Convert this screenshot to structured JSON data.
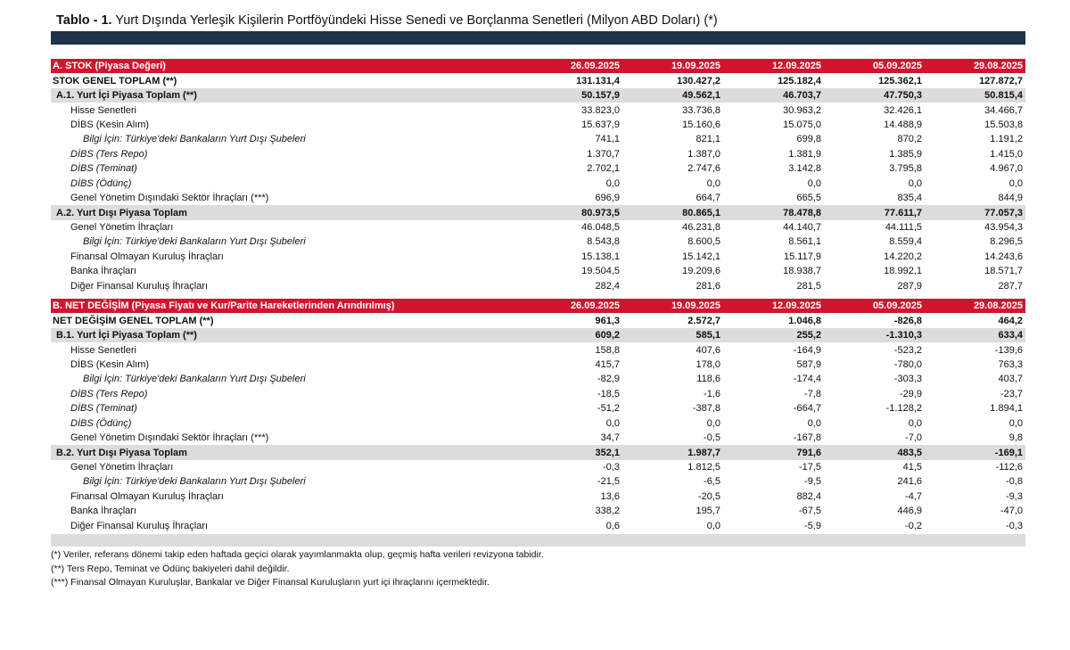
{
  "title": {
    "prefix": "Tablo - 1.",
    "text": " Yurt Dışında Yerleşik Kişilerin Portföyündeki Hisse Senedi ve Borçlanma Senetleri (Milyon ABD Doları) (*)"
  },
  "colors": {
    "header_red": "#d2142e",
    "navy_bar": "#1f3349",
    "subtotal_gray": "#dcdcdc"
  },
  "sections": [
    {
      "header": "A. STOK (Piyasa Değeri)",
      "dates": [
        "26.09.2025",
        "19.09.2025",
        "12.09.2025",
        "05.09.2025",
        "29.08.2025"
      ],
      "rows": [
        {
          "label": "STOK GENEL TOPLAM (**)",
          "type": "total",
          "values": [
            "131.131,4",
            "130.427,2",
            "125.182,4",
            "125.362,1",
            "127.872,7"
          ]
        },
        {
          "label": "A.1. Yurt İçi Piyasa Toplam (**)",
          "type": "sub",
          "values": [
            "50.157,9",
            "49.562,1",
            "46.703,7",
            "47.750,3",
            "50.815,4"
          ]
        },
        {
          "label": "Hisse Senetleri",
          "type": "l2",
          "values": [
            "33.823,0",
            "33.736,8",
            "30.963,2",
            "32.426,1",
            "34.466,7"
          ]
        },
        {
          "label": "DİBS (Kesin Alım)",
          "type": "l2",
          "values": [
            "15.637,9",
            "15.160,6",
            "15.075,0",
            "14.488,9",
            "15.503,8"
          ]
        },
        {
          "label": "Bilgi İçin: Türkiye'deki Bankaların Yurt Dışı Şubeleri",
          "type": "l3",
          "values": [
            "741,1",
            "821,1",
            "699,8",
            "870,2",
            "1.191,2"
          ]
        },
        {
          "label": "DİBS (Ters Repo)",
          "type": "l2i",
          "values": [
            "1.370,7",
            "1.387,0",
            "1.381,9",
            "1.385,9",
            "1.415,0"
          ]
        },
        {
          "label": "DİBS (Teminat)",
          "type": "l2i",
          "values": [
            "2.702,1",
            "2.747,6",
            "3.142,8",
            "3.795,8",
            "4.967,0"
          ]
        },
        {
          "label": "DİBS (Ödünç)",
          "type": "l2i",
          "values": [
            "0,0",
            "0,0",
            "0,0",
            "0,0",
            "0,0"
          ]
        },
        {
          "label": "Genel Yönetim Dışındaki Sektör İhraçları (***)",
          "type": "l2",
          "values": [
            "696,9",
            "664,7",
            "665,5",
            "835,4",
            "844,9"
          ]
        },
        {
          "label": "A.2. Yurt Dışı Piyasa Toplam",
          "type": "sub",
          "values": [
            "80.973,5",
            "80.865,1",
            "78.478,8",
            "77.611,7",
            "77.057,3"
          ]
        },
        {
          "label": "Genel Yönetim İhraçları",
          "type": "l2",
          "values": [
            "46.048,5",
            "46.231,8",
            "44.140,7",
            "44.111,5",
            "43.954,3"
          ]
        },
        {
          "label": "Bilgi İçin: Türkiye'deki Bankaların Yurt Dışı Şubeleri",
          "type": "l3",
          "values": [
            "8.543,8",
            "8.600,5",
            "8.561,1",
            "8.559,4",
            "8.296,5"
          ]
        },
        {
          "label": "Finansal Olmayan Kuruluş İhraçları",
          "type": "l2",
          "values": [
            "15.138,1",
            "15.142,1",
            "15.117,9",
            "14.220,2",
            "14.243,6"
          ]
        },
        {
          "label": "Banka İhraçları",
          "type": "l2",
          "values": [
            "19.504,5",
            "19.209,6",
            "18.938,7",
            "18.992,1",
            "18.571,7"
          ]
        },
        {
          "label": "Diğer Finansal Kuruluş İhraçları",
          "type": "l2",
          "values": [
            "282,4",
            "281,6",
            "281,5",
            "287,9",
            "287,7"
          ]
        }
      ]
    },
    {
      "header": "B. NET DEĞİŞİM (Piyasa Fiyatı ve Kur/Parite Hareketlerinden Arındırılmış)",
      "dates": [
        "26.09.2025",
        "19.09.2025",
        "12.09.2025",
        "05.09.2025",
        "29.08.2025"
      ],
      "rows": [
        {
          "label": "NET DEĞİŞİM GENEL TOPLAM (**)",
          "type": "total",
          "values": [
            "961,3",
            "2.572,7",
            "1.046,8",
            "-826,8",
            "464,2"
          ]
        },
        {
          "label": "B.1. Yurt İçi Piyasa Toplam (**)",
          "type": "sub",
          "values": [
            "609,2",
            "585,1",
            "255,2",
            "-1.310,3",
            "633,4"
          ]
        },
        {
          "label": "Hisse Senetleri",
          "type": "l2",
          "values": [
            "158,8",
            "407,6",
            "-164,9",
            "-523,2",
            "-139,6"
          ]
        },
        {
          "label": "DİBS (Kesin Alım)",
          "type": "l2",
          "values": [
            "415,7",
            "178,0",
            "587,9",
            "-780,0",
            "763,3"
          ]
        },
        {
          "label": "Bilgi İçin: Türkiye'deki Bankaların Yurt Dışı Şubeleri",
          "type": "l3",
          "values": [
            "-82,9",
            "118,6",
            "-174,4",
            "-303,3",
            "403,7"
          ]
        },
        {
          "label": "DİBS (Ters Repo)",
          "type": "l2i",
          "values": [
            "-18,5",
            "-1,6",
            "-7,8",
            "-29,9",
            "-23,7"
          ]
        },
        {
          "label": "DİBS (Teminat)",
          "type": "l2i",
          "values": [
            "-51,2",
            "-387,8",
            "-664,7",
            "-1.128,2",
            "1.894,1"
          ]
        },
        {
          "label": "DİBS (Ödünç)",
          "type": "l2i",
          "values": [
            "0,0",
            "0,0",
            "0,0",
            "0,0",
            "0,0"
          ]
        },
        {
          "label": "Genel Yönetim Dışındaki Sektör İhraçları (***)",
          "type": "l2",
          "values": [
            "34,7",
            "-0,5",
            "-167,8",
            "-7,0",
            "9,8"
          ]
        },
        {
          "label": "B.2. Yurt Dışı Piyasa Toplam",
          "type": "sub",
          "values": [
            "352,1",
            "1.987,7",
            "791,6",
            "483,5",
            "-169,1"
          ]
        },
        {
          "label": "Genel Yönetim İhraçları",
          "type": "l2",
          "values": [
            "-0,3",
            "1.812,5",
            "-17,5",
            "41,5",
            "-112,6"
          ]
        },
        {
          "label": "Bilgi İçin: Türkiye'deki Bankaların Yurt Dışı Şubeleri",
          "type": "l3",
          "values": [
            "-21,5",
            "-6,5",
            "-9,5",
            "241,6",
            "-0,8"
          ]
        },
        {
          "label": "Finansal Olmayan Kuruluş İhraçları",
          "type": "l2",
          "values": [
            "13,6",
            "-20,5",
            "882,4",
            "-4,7",
            "-9,3"
          ]
        },
        {
          "label": "Banka İhraçları",
          "type": "l2",
          "values": [
            "338,2",
            "195,7",
            "-67,5",
            "446,9",
            "-47,0"
          ]
        },
        {
          "label": "Diğer Finansal Kuruluş İhraçları",
          "type": "l2",
          "values": [
            "0,6",
            "0,0",
            "-5,9",
            "-0,2",
            "-0,3"
          ]
        }
      ]
    }
  ],
  "footnotes": [
    "(*) Veriler, referans dönemi takip eden haftada geçici olarak yayımlanmakta olup, geçmiş hafta verileri revizyona tabidir.",
    "(**) Ters Repo, Teminat ve Ödünç bakiyeleri dahil değildir.",
    "(***) Finansal Olmayan Kuruluşlar, Bankalar ve Diğer Finansal Kuruluşların yurt içi ihraçlarını içermektedir."
  ]
}
